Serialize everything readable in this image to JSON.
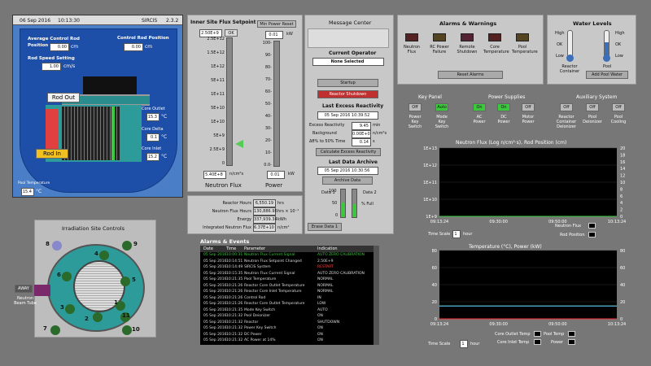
{
  "reactor": {
    "date": "06 Sep 2016",
    "time": "10:13:30",
    "app": "SIRCIS",
    "version": "2.3.2",
    "avg_rod_label": "Average Control Rod Position",
    "avg_rod_val": "0.00",
    "avg_rod_unit": "cm",
    "rod_pos_label": "Control Rod Position",
    "rod_pos_val": "0.00",
    "rod_pos_unit": "cm",
    "speed_label": "Rod Speed Setting",
    "speed_val": "1.00",
    "speed_unit": "cm/s",
    "rod_out": "Rod Out",
    "rod_in": "Rod In",
    "core_outlet": "Core Outlet",
    "core_outlet_val": "15.3",
    "core_delta": "Core Delta",
    "core_delta_val": "0.1",
    "core_inlet": "Core Inlet",
    "core_inlet_val": "15.2",
    "deg": "°C",
    "pool_temp_label": "Pool Temperature",
    "pool_temp_val": "15.4"
  },
  "flux": {
    "title": "Inner Site Flux Setpoint",
    "setpoint": "2.50E+9",
    "ok": "OK",
    "ticks": [
      "2.5E+12",
      "1.5E+12",
      "1E+12",
      "5E+11",
      "1E+11",
      "5E+10",
      "1E+10",
      "5E+9",
      "2.5E+9",
      "0"
    ],
    "value": "5.40E+8",
    "unit": "n/cm²s",
    "name": "Neutron Flux"
  },
  "power": {
    "reset": "Min Power Reset",
    "value_top": "0.01",
    "unit": "kW",
    "ticks": [
      "100-",
      "90-",
      "80-",
      "70-",
      "60-",
      "50-",
      "40-",
      "30-",
      "20-",
      "10-",
      "0.0-"
    ],
    "value": "0.01",
    "name": "Power"
  },
  "integrals": {
    "rows": [
      {
        "label": "Reactor Hours",
        "val": "6,550.19",
        "unit": "hrs"
      },
      {
        "label": "Neutron Flux Hours",
        "val": "130,886.96",
        "unit": "hrs × 10⁻¹"
      },
      {
        "label": "Energy",
        "val": "337,939.34",
        "unit": "kWh"
      },
      {
        "label": "Integrated Neutron Flux",
        "val": "6.37E+10",
        "unit": "n/cm²"
      }
    ]
  },
  "message": {
    "title": "Message Center",
    "operator_label": "Current Operator",
    "operator": "None Selected",
    "startup": "Startup",
    "shutdown": "Reactor Shutdown",
    "excess_title": "Last Excess Reactivity",
    "excess_date": "05 Sep 2016 10:39:52",
    "excess_rows": [
      {
        "label": "Excess Reactivity",
        "val": "9.45",
        "unit": "min"
      },
      {
        "label": "Background",
        "val": "0.00E+0",
        "unit": "n/cm²s"
      },
      {
        "label": "Δθ% to 50% Time",
        "val": "0.14",
        "unit": "s"
      }
    ],
    "calc": "Calculate Excess Reactivity",
    "archive_title": "Last Data Archive",
    "archive_date": "05 Sep 2016 10:30:56",
    "archive_btn": "Archive Data",
    "data1": "Data 1",
    "data2": "Data 2",
    "pct": "% Full",
    "erase": "Erase Data 1",
    "pct_ticks": [
      "100",
      "50",
      "0"
    ]
  },
  "alarms": {
    "title": "Alarms & Warnings",
    "items": [
      "Neutron Flux",
      "RC Power Failure",
      "Remote Shutdown",
      "Core Temperature",
      "Pool Temperature"
    ],
    "reset": "Reset Alarms"
  },
  "water": {
    "title": "Water Levels",
    "high": "High",
    "ok": "OK",
    "low": "Low",
    "left": "Reactor Container",
    "right": "Pool",
    "add": "Add Pool Water"
  },
  "keypanel": {
    "title": "Key Panel",
    "items": [
      {
        "btn": "Off",
        "label": "Power Key Switch"
      },
      {
        "btn": "Auto",
        "label": "Mode Key Switch"
      }
    ]
  },
  "supplies": {
    "title": "Power Supplies",
    "items": [
      {
        "btn": "On",
        "label": "AC Power"
      },
      {
        "btn": "On",
        "label": "DC Power"
      },
      {
        "btn": "Off",
        "label": "Motor Power"
      }
    ]
  },
  "aux": {
    "title": "Auxiliary System",
    "items": [
      {
        "btn": "Off",
        "label": "Reactor Container Deionizer"
      },
      {
        "btn": "Off",
        "label": "Pool Deionizer"
      },
      {
        "btn": "Off",
        "label": "Pool Cooling"
      }
    ]
  },
  "chart_data": [
    {
      "type": "line",
      "title": "Neutron Flux (Log n/cm²·s), Rod Position (cm)",
      "y_left": [
        "1E+13",
        "1E+12",
        "1E+11",
        "1E+10",
        "1E+9"
      ],
      "y_right": [
        "20",
        "18",
        "16",
        "14",
        "12",
        "10",
        "8",
        "6",
        "4",
        "2",
        "0"
      ],
      "x": [
        "09:13:24",
        "09:30:00",
        "09:50:00",
        "10:13:24"
      ],
      "series": [
        {
          "name": "Neutron Flux",
          "values": [
            1000000000.0,
            1000000000.0
          ]
        },
        {
          "name": "Rod Position",
          "values": [
            0,
            0
          ]
        }
      ],
      "timescale_label": "Time Scale",
      "timescale_val": "1",
      "timescale_unit": "hour",
      "ylim": [
        1000000000.0,
        10000000000000.0
      ]
    },
    {
      "type": "line",
      "title": "Temperature (°C), Power (kW)",
      "y_left": [
        "80",
        "60",
        "40",
        "20",
        "0"
      ],
      "y_right": [
        "80",
        "60",
        "40",
        "20",
        "0"
      ],
      "x": [
        "09:13:24",
        "09:30:00",
        "09:50:00",
        "10:13:24"
      ],
      "series": [
        {
          "name": "Core Outlet Temp",
          "values": [
            15,
            15
          ]
        },
        {
          "name": "Core Inlet Temp",
          "values": [
            15,
            15
          ]
        },
        {
          "name": "Pool Temp",
          "values": [
            15,
            15
          ]
        },
        {
          "name": "Power",
          "values": [
            0,
            0
          ]
        }
      ],
      "timescale_label": "Time Scale",
      "timescale_val": "1",
      "timescale_unit": "hour",
      "ylim": [
        0,
        80
      ]
    }
  ],
  "irradiation": {
    "title": "Irradiation Site Controls",
    "sites": [
      "8",
      "9",
      "4",
      "5",
      "6",
      "3",
      "7",
      "1",
      "2",
      "11",
      "10"
    ],
    "away": "AWAY",
    "beam_tube": "Neutron Beam Tube"
  },
  "events": {
    "title": "Alarms & Events",
    "headers": [
      "Date",
      "Time",
      "Parameter",
      "Indication"
    ],
    "rows": [
      [
        "05 Sep 2016",
        "10:00:31",
        "Neutron Flux Current Signal",
        "AUTO ZERO CALIBRATION"
      ],
      [
        "05 Sep 2016",
        "10:14:51",
        "Neutron Flux Setpoint Changed",
        "2.50E+9"
      ],
      [
        "05 Sep 2016",
        "10:14:49",
        "SIRCIS System",
        "RESTART"
      ],
      [
        "05 Sep 2016",
        "10:15:35",
        "Neutron Flux Current Signal",
        "AUTO ZERO CALIBRATION"
      ],
      [
        "05 Sep 2016",
        "10:21:35",
        "Pool Temperature",
        "NORMAL"
      ],
      [
        "05 Sep 2016",
        "10:21:26",
        "Reactor Core Outlet Temperature",
        "NORMAL"
      ],
      [
        "05 Sep 2016",
        "10:21:26",
        "Reactor Core Inlet Temperature",
        "NORMAL"
      ],
      [
        "05 Sep 2016",
        "10:21:26",
        "Control Rod",
        "IN"
      ],
      [
        "05 Sep 2016",
        "10:21:26",
        "Reactor Core Outlet Temperature",
        "LOW"
      ],
      [
        "05 Sep 2016",
        "10:21:35",
        "Mode Key Switch",
        "AUTO"
      ],
      [
        "05 Sep 2016",
        "10:21:32",
        "Pool Deionizer",
        "ON"
      ],
      [
        "05 Sep 2016",
        "10:21:32",
        "Reactor",
        "SHUTDOWN"
      ],
      [
        "05 Sep 2016",
        "10:21:32",
        "Power Key Switch",
        "ON"
      ],
      [
        "05 Sep 2016",
        "10:21:32",
        "DC Power",
        "ON"
      ],
      [
        "05 Sep 2016",
        "10:21:32",
        "AC Power at 14%",
        "ON"
      ]
    ]
  },
  "colors": {
    "teal": "#2e9b9b",
    "blue": "#3d6fb8",
    "green": "#3cc83c",
    "red": "#c03030"
  }
}
